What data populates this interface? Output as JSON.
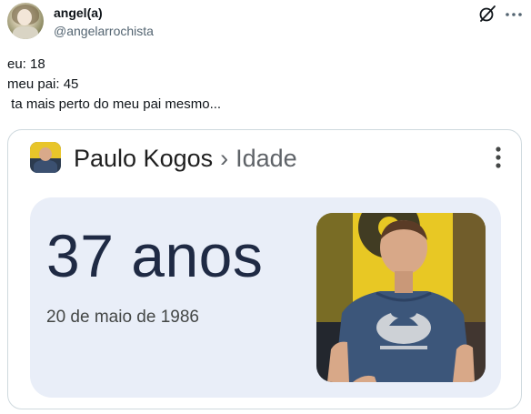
{
  "tweet": {
    "author": {
      "display_name": "angel(a)",
      "handle": "@angelarrochista"
    },
    "lines": [
      "eu: 18",
      "meu pai: 45",
      " ta mais perto do meu pai mesmo..."
    ],
    "icons": {
      "grok": "grok-slash-icon",
      "more": "more-options-icon"
    }
  },
  "search_card": {
    "entity": "Paulo Kogos",
    "separator": "›",
    "attribute": "Idade",
    "answer": "37 anos",
    "detail": "20 de maio de 1986",
    "colors": {
      "panel_bg": "#e9eef8",
      "answer_text": "#1f2a44",
      "flag_yellow": "#f0d21e",
      "shirt_blue": "#3c567a"
    }
  }
}
